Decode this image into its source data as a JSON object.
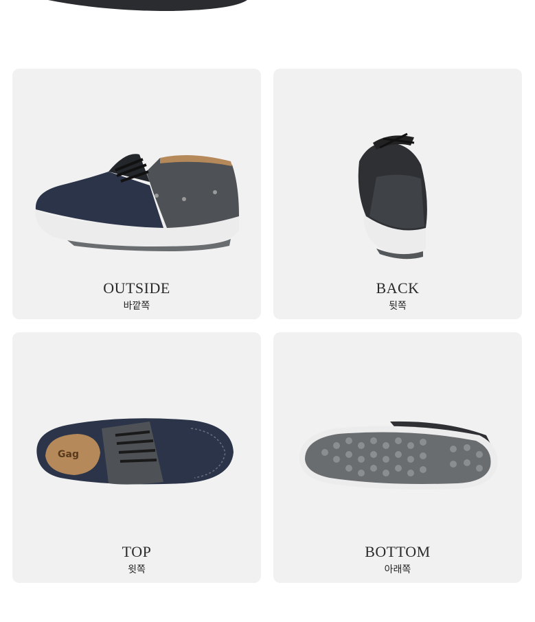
{
  "views": [
    {
      "id": "outside",
      "label_en": "OUTSIDE",
      "label_ko": "바깥쪽"
    },
    {
      "id": "back",
      "label_en": "BACK",
      "label_ko": "뒷쪽"
    },
    {
      "id": "top",
      "label_en": "TOP",
      "label_ko": "윗쪽"
    },
    {
      "id": "bottom",
      "label_en": "BOTTOM",
      "label_ko": "아래쪽"
    }
  ],
  "colors": {
    "card_bg": "#f1f1f1",
    "navy_leather": "#2b3448",
    "grey_leather": "#4e5155",
    "sole_white": "#ececec",
    "sole_grey": "#6a6d70",
    "lining_tan": "#b5895a"
  },
  "insole_text": "Gag"
}
